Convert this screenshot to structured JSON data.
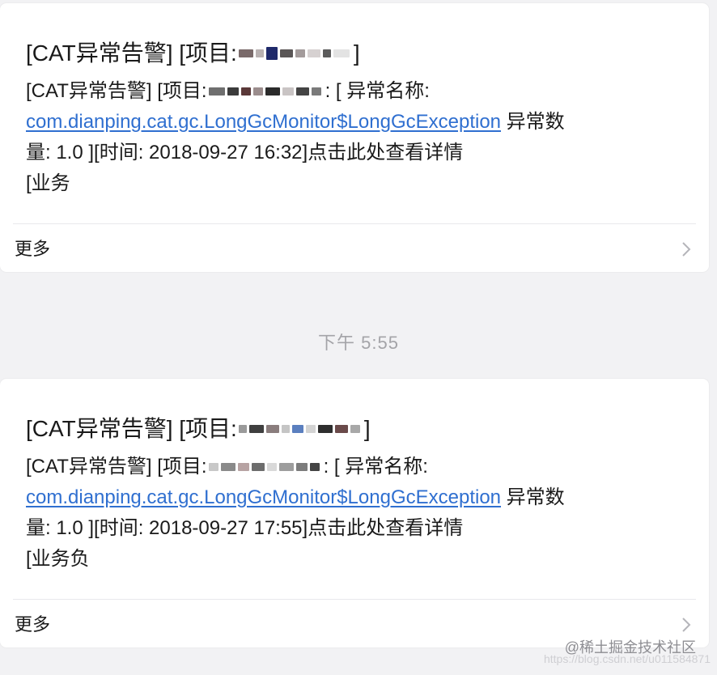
{
  "messages": [
    {
      "title_prefix": "[CAT异常告警] [项目: ",
      "title_suffix": "]",
      "line1_prefix": "[CAT异常告警] [项目: ",
      "line1_suffix": ": [ 异常名称:",
      "exception_link": "com.dianping.cat.gc.LongGcMonitor$LongGcException",
      "line2_tail": " 异常数",
      "line3": "量: 1.0 ][时间: 2018-09-27 16:32]点击此处查看详情",
      "line4": "[业务",
      "more_label": "更多"
    },
    {
      "title_prefix": "[CAT异常告警] [项目: ",
      "title_suffix": "]",
      "line1_prefix": "[CAT异常告警] [项目: ",
      "line1_suffix": ": [ 异常名称:",
      "exception_link": "com.dianping.cat.gc.LongGcMonitor$LongGcException",
      "line2_tail": " 异常数",
      "line3": "量: 1.0 ][时间: 2018-09-27 17:55]点击此处查看详情",
      "line4": "[业务负",
      "more_label": "更多"
    }
  ],
  "timestamp": "下午 5:55",
  "watermark": "@稀土掘金技术社区",
  "watermark_url": "https://blog.csdn.net/u011584871",
  "colors": {
    "link": "#2f6fd0",
    "background": "#f2f2f4",
    "card": "#ffffff",
    "timestamp": "#a4a4a8"
  },
  "icons": {
    "more": "chevron-right-icon"
  }
}
